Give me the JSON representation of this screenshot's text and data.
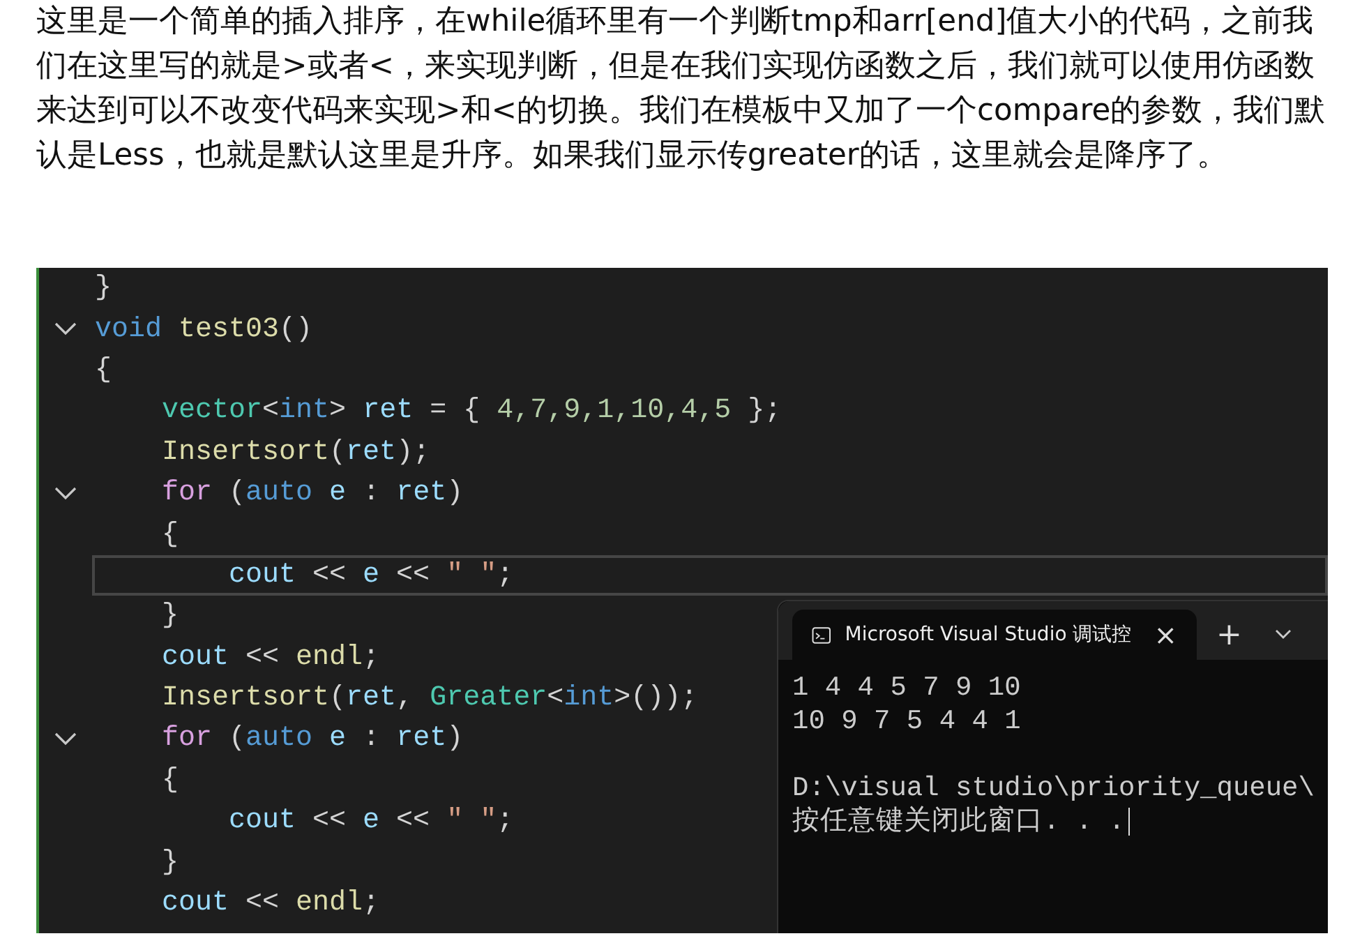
{
  "article": {
    "paragraph": "这里是一个简单的插入排序，在while循环里有一个判断tmp和arr[end]值大小的代码，之前我们在这里写的就是>或者<，来实现判断，但是在我们实现仿函数之后，我们就可以使用仿函数来达到可以不改变代码来实现>和<的切换。我们在模板中又加了一个compare的参数，我们默认是Less，也就是默认这里是升序。如果我们显示传greater的话，这里就会是降序了。"
  },
  "editor": {
    "lines": [
      {
        "fold": false,
        "current": false,
        "tokens": [
          {
            "t": "}",
            "color": "#d4d4d4"
          }
        ]
      },
      {
        "fold": true,
        "current": false,
        "tokens": [
          {
            "t": "void ",
            "color": "#569cd6"
          },
          {
            "t": "test03",
            "color": "#dcdcaa"
          },
          {
            "t": "()",
            "color": "#d4d4d4"
          }
        ]
      },
      {
        "fold": false,
        "current": false,
        "tokens": [
          {
            "t": "{",
            "color": "#d4d4d4"
          }
        ],
        "children": [
          {
            "fold": false,
            "current": false,
            "tokens": [
              {
                "t": "vector",
                "color": "#4ec9b0"
              },
              {
                "t": "<",
                "color": "#d4d4d4"
              },
              {
                "t": "int",
                "color": "#569cd6"
              },
              {
                "t": "> ",
                "color": "#d4d4d4"
              },
              {
                "t": "ret",
                "color": "#9cdcfe"
              },
              {
                "t": " = { ",
                "color": "#d4d4d4"
              },
              {
                "t": "4,7,9,1,10,4,5",
                "color": "#b5cea8"
              },
              {
                "t": " };",
                "color": "#d4d4d4"
              }
            ]
          },
          {
            "fold": false,
            "current": false,
            "tokens": [
              {
                "t": "Insertsort",
                "color": "#dcdcaa"
              },
              {
                "t": "(",
                "color": "#d4d4d4"
              },
              {
                "t": "ret",
                "color": "#9cdcfe"
              },
              {
                "t": ");",
                "color": "#d4d4d4"
              }
            ]
          },
          {
            "fold": true,
            "current": false,
            "tokens": [
              {
                "t": "for",
                "color": "#d8a0df"
              },
              {
                "t": " (",
                "color": "#d4d4d4"
              },
              {
                "t": "auto ",
                "color": "#569cd6"
              },
              {
                "t": "e",
                "color": "#9cdcfe"
              },
              {
                "t": " : ",
                "color": "#d4d4d4"
              },
              {
                "t": "ret",
                "color": "#9cdcfe"
              },
              {
                "t": ")",
                "color": "#d4d4d4"
              }
            ]
          },
          {
            "fold": false,
            "current": false,
            "tokens": [
              {
                "t": "{",
                "color": "#d4d4d4"
              }
            ],
            "children": [
              {
                "fold": false,
                "current": true,
                "tokens": [
                  {
                    "t": "cout",
                    "color": "#9cdcfe"
                  },
                  {
                    "t": " << ",
                    "color": "#d4d4d4"
                  },
                  {
                    "t": "e",
                    "color": "#9cdcfe"
                  },
                  {
                    "t": " << ",
                    "color": "#d4d4d4"
                  },
                  {
                    "t": "\" \"",
                    "color": "#d69d85"
                  },
                  {
                    "t": ";",
                    "color": "#d4d4d4"
                  }
                ]
              }
            ]
          },
          {
            "fold": false,
            "current": false,
            "tokens": [
              {
                "t": "}",
                "color": "#d4d4d4"
              }
            ]
          },
          {
            "fold": false,
            "current": false,
            "tokens": [
              {
                "t": "cout",
                "color": "#9cdcfe"
              },
              {
                "t": " << ",
                "color": "#d4d4d4"
              },
              {
                "t": "endl",
                "color": "#dcdcaa"
              },
              {
                "t": ";",
                "color": "#d4d4d4"
              }
            ]
          },
          {
            "fold": false,
            "current": false,
            "tokens": [
              {
                "t": "Insertsort",
                "color": "#dcdcaa"
              },
              {
                "t": "(",
                "color": "#d4d4d4"
              },
              {
                "t": "ret",
                "color": "#9cdcfe"
              },
              {
                "t": ", ",
                "color": "#d4d4d4"
              },
              {
                "t": "Greater",
                "color": "#4ec9b0"
              },
              {
                "t": "<",
                "color": "#d4d4d4"
              },
              {
                "t": "int",
                "color": "#569cd6"
              },
              {
                "t": ">());",
                "color": "#d4d4d4"
              }
            ]
          },
          {
            "fold": true,
            "current": false,
            "tokens": [
              {
                "t": "for",
                "color": "#d8a0df"
              },
              {
                "t": " (",
                "color": "#d4d4d4"
              },
              {
                "t": "auto ",
                "color": "#569cd6"
              },
              {
                "t": "e",
                "color": "#9cdcfe"
              },
              {
                "t": " : ",
                "color": "#d4d4d4"
              },
              {
                "t": "ret",
                "color": "#9cdcfe"
              },
              {
                "t": ")",
                "color": "#d4d4d4"
              }
            ]
          },
          {
            "fold": false,
            "current": false,
            "tokens": [
              {
                "t": "{",
                "color": "#d4d4d4"
              }
            ],
            "children": [
              {
                "fold": false,
                "current": false,
                "tokens": [
                  {
                    "t": "cout",
                    "color": "#9cdcfe"
                  },
                  {
                    "t": " << ",
                    "color": "#d4d4d4"
                  },
                  {
                    "t": "e",
                    "color": "#9cdcfe"
                  },
                  {
                    "t": " << ",
                    "color": "#d4d4d4"
                  },
                  {
                    "t": "\" \"",
                    "color": "#d69d85"
                  },
                  {
                    "t": ";",
                    "color": "#d4d4d4"
                  }
                ]
              }
            ]
          },
          {
            "fold": false,
            "current": false,
            "tokens": [
              {
                "t": "}",
                "color": "#d4d4d4"
              }
            ]
          },
          {
            "fold": false,
            "current": false,
            "tokens": [
              {
                "t": "cout",
                "color": "#9cdcfe"
              },
              {
                "t": " << ",
                "color": "#d4d4d4"
              },
              {
                "t": "endl",
                "color": "#dcdcaa"
              },
              {
                "t": ";",
                "color": "#d4d4d4"
              }
            ]
          }
        ]
      }
    ]
  },
  "terminal": {
    "tab_title": "Microsoft Visual Studio 调试控",
    "close": "×",
    "new_tab": "+",
    "results": [
      "1 4 4 5 7 9 10",
      "10 9 7 5 4 4 1"
    ],
    "prompt": [
      "D:\\visual studio\\priority_queue\\",
      "按任意键关闭此窗口. . ."
    ]
  }
}
